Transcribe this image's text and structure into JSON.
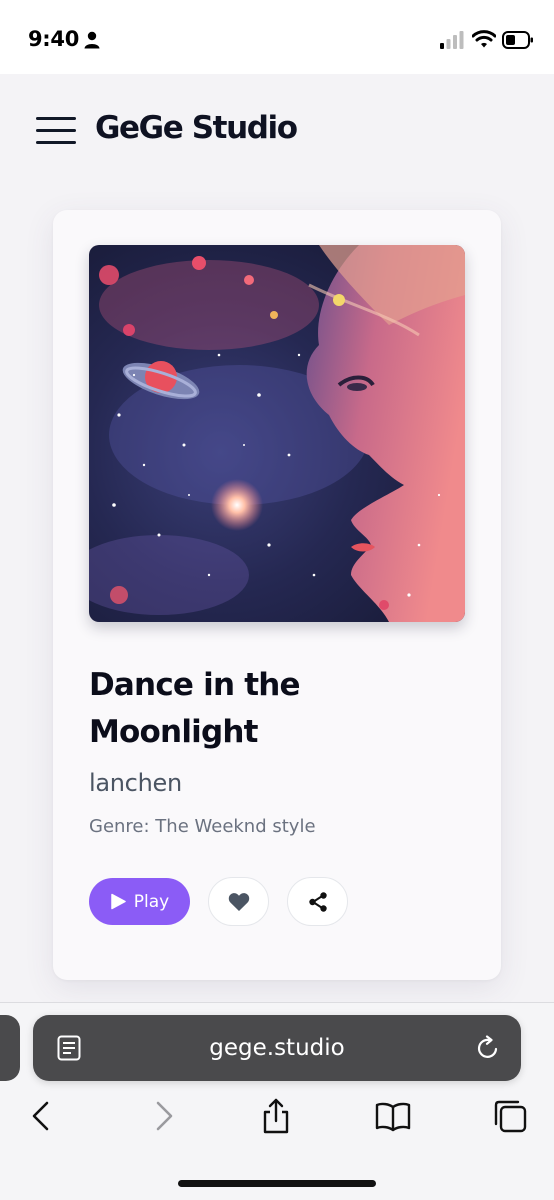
{
  "status_bar": {
    "time": "9:40",
    "icons": [
      "person-icon",
      "cellular-signal-icon",
      "wifi-icon",
      "battery-icon"
    ]
  },
  "header": {
    "menu_icon": "hamburger-menu-icon",
    "brand": "GeGe Studio"
  },
  "song": {
    "cover_art": "cosmic-portrait-artwork",
    "title": "Dance in the Moonlight",
    "artist": "lanchen",
    "genre": "Genre: The Weeknd style"
  },
  "actions": {
    "play_label": "Play",
    "play_icon": "play-icon",
    "like_icon": "heart-icon",
    "share_icon": "share-icon"
  },
  "browser": {
    "url": "gege.studio",
    "reader_icon": "reader-page-icon",
    "reload_icon": "reload-icon",
    "toolbar_icons": [
      "back-arrow-icon",
      "forward-arrow-icon",
      "share-up-icon",
      "bookmarks-icon",
      "tabs-icon"
    ]
  },
  "colors": {
    "accent": "#8b5cf6",
    "url_bar": "#4a4a4c",
    "page_background": "#f4f3f6"
  }
}
